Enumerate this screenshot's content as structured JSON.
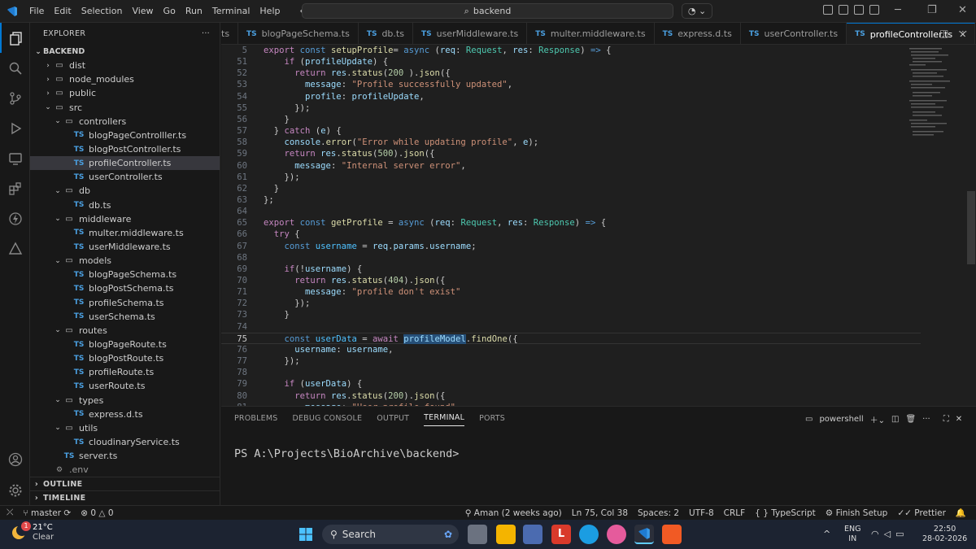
{
  "titlebar": {
    "menu": [
      "File",
      "Edit",
      "Selection",
      "View",
      "Go",
      "Run",
      "Terminal",
      "Help"
    ],
    "search": "backend"
  },
  "explorer": {
    "header": "EXPLORER",
    "root": "BACKEND",
    "tree": [
      {
        "depth": 1,
        "kind": "folder",
        "open": false,
        "name": "dist"
      },
      {
        "depth": 1,
        "kind": "folder",
        "open": false,
        "name": "node_modules"
      },
      {
        "depth": 1,
        "kind": "folder",
        "open": false,
        "name": "public"
      },
      {
        "depth": 1,
        "kind": "folder",
        "open": true,
        "name": "src"
      },
      {
        "depth": 2,
        "kind": "folder",
        "open": true,
        "name": "controllers"
      },
      {
        "depth": 3,
        "kind": "ts",
        "name": "blogPageControlller.ts"
      },
      {
        "depth": 3,
        "kind": "ts",
        "name": "blogPostController.ts"
      },
      {
        "depth": 3,
        "kind": "ts",
        "name": "profileController.ts",
        "selected": true
      },
      {
        "depth": 3,
        "kind": "ts",
        "name": "userController.ts"
      },
      {
        "depth": 2,
        "kind": "folder",
        "open": true,
        "name": "db"
      },
      {
        "depth": 3,
        "kind": "ts",
        "name": "db.ts"
      },
      {
        "depth": 2,
        "kind": "folder",
        "open": true,
        "name": "middleware"
      },
      {
        "depth": 3,
        "kind": "ts",
        "name": "multer.middleware.ts"
      },
      {
        "depth": 3,
        "kind": "ts",
        "name": "userMiddleware.ts"
      },
      {
        "depth": 2,
        "kind": "folder",
        "open": true,
        "name": "models"
      },
      {
        "depth": 3,
        "kind": "ts",
        "name": "blogPageSchema.ts"
      },
      {
        "depth": 3,
        "kind": "ts",
        "name": "blogPostSchema.ts"
      },
      {
        "depth": 3,
        "kind": "ts",
        "name": "profileSchema.ts"
      },
      {
        "depth": 3,
        "kind": "ts",
        "name": "userSchema.ts"
      },
      {
        "depth": 2,
        "kind": "folder",
        "open": true,
        "name": "routes"
      },
      {
        "depth": 3,
        "kind": "ts",
        "name": "blogPageRoute.ts"
      },
      {
        "depth": 3,
        "kind": "ts",
        "name": "blogPostRoute.ts"
      },
      {
        "depth": 3,
        "kind": "ts",
        "name": "profileRoute.ts"
      },
      {
        "depth": 3,
        "kind": "ts",
        "name": "userRoute.ts"
      },
      {
        "depth": 2,
        "kind": "folder",
        "open": true,
        "name": "types"
      },
      {
        "depth": 3,
        "kind": "ts",
        "name": "express.d.ts"
      },
      {
        "depth": 2,
        "kind": "folder",
        "open": true,
        "name": "utils"
      },
      {
        "depth": 3,
        "kind": "ts",
        "name": "cloudinaryService.ts"
      },
      {
        "depth": 2,
        "kind": "ts",
        "name": "server.ts"
      },
      {
        "depth": 1,
        "kind": "env",
        "name": ".env"
      }
    ],
    "outline": "OUTLINE",
    "timeline": "TIMELINE"
  },
  "tabs": [
    {
      "label": "ts",
      "icon": ""
    },
    {
      "label": "blogPageSchema.ts",
      "icon": "TS"
    },
    {
      "label": "db.ts",
      "icon": "TS"
    },
    {
      "label": "userMiddleware.ts",
      "icon": "TS"
    },
    {
      "label": "multer.middleware.ts",
      "icon": "TS"
    },
    {
      "label": "express.d.ts",
      "icon": "TS"
    },
    {
      "label": "userController.ts",
      "icon": "TS"
    },
    {
      "label": "profileController.ts",
      "icon": "TS",
      "active": true
    }
  ],
  "code": [
    {
      "n": "5",
      "t": [
        [
          "kw",
          "export "
        ],
        [
          "kd",
          "const "
        ],
        [
          "fn",
          "setupProfile"
        ],
        [
          "",
          "="
        ],
        [
          "kd",
          " async "
        ],
        [
          "",
          "("
        ],
        [
          "va",
          "req"
        ],
        [
          "",
          ": "
        ],
        [
          "ty",
          "Request"
        ],
        [
          "",
          ", "
        ],
        [
          "va",
          "res"
        ],
        [
          "",
          ": "
        ],
        [
          "ty",
          "Response"
        ],
        [
          "",
          ") "
        ],
        [
          "kd",
          "=>"
        ],
        [
          "",
          " {"
        ]
      ]
    },
    {
      "n": "51",
      "t": [
        [
          "",
          "    "
        ],
        [
          "kw",
          "if "
        ],
        [
          "",
          "("
        ],
        [
          "va",
          "profileUpdate"
        ],
        [
          ") {",
          ""
        ]
      ]
    },
    {
      "n": "52",
      "t": [
        [
          "",
          "      "
        ],
        [
          "kw",
          "return "
        ],
        [
          "va",
          "res"
        ],
        [
          "",
          "."
        ],
        [
          "fn",
          "status"
        ],
        [
          "",
          "("
        ],
        [
          "nu",
          "200"
        ],
        [
          "",
          " )."
        ],
        [
          "fn",
          "json"
        ],
        [
          "",
          "({"
        ]
      ]
    },
    {
      "n": "53",
      "t": [
        [
          "",
          "        "
        ],
        [
          "va",
          "message"
        ],
        [
          "",
          ": "
        ],
        [
          "st",
          "\"Profile successfully updated\""
        ],
        [
          "",
          ","
        ]
      ]
    },
    {
      "n": "54",
      "t": [
        [
          "",
          "        "
        ],
        [
          "va",
          "profile"
        ],
        [
          "",
          ": "
        ],
        [
          "va",
          "profileUpdate"
        ],
        [
          "",
          ","
        ]
      ]
    },
    {
      "n": "55",
      "t": [
        [
          "",
          "      });"
        ]
      ]
    },
    {
      "n": "56",
      "t": [
        [
          "",
          "    }"
        ]
      ]
    },
    {
      "n": "57",
      "t": [
        [
          "",
          "  } "
        ],
        [
          "kw",
          "catch "
        ],
        [
          "",
          "("
        ],
        [
          "va",
          "e"
        ],
        [
          "",
          ") {"
        ]
      ]
    },
    {
      "n": "58",
      "t": [
        [
          "",
          "    "
        ],
        [
          "va",
          "console"
        ],
        [
          "",
          "."
        ],
        [
          "fn",
          "error"
        ],
        [
          "",
          "("
        ],
        [
          "st",
          "\"Error while updating profile\""
        ],
        [
          "",
          ", "
        ],
        [
          "va",
          "e"
        ],
        [
          "",
          ");"
        ]
      ]
    },
    {
      "n": "59",
      "t": [
        [
          "",
          "    "
        ],
        [
          "kw",
          "return "
        ],
        [
          "va",
          "res"
        ],
        [
          "",
          "."
        ],
        [
          "fn",
          "status"
        ],
        [
          "",
          "("
        ],
        [
          "nu",
          "500"
        ],
        [
          "",
          ")."
        ],
        [
          "fn",
          "json"
        ],
        [
          "",
          "({"
        ]
      ]
    },
    {
      "n": "60",
      "t": [
        [
          "",
          "      "
        ],
        [
          "va",
          "message"
        ],
        [
          "",
          ": "
        ],
        [
          "st",
          "\"Internal server error\""
        ],
        [
          "",
          ","
        ]
      ]
    },
    {
      "n": "61",
      "t": [
        [
          "",
          "    });"
        ]
      ]
    },
    {
      "n": "62",
      "t": [
        [
          "",
          "  }"
        ]
      ]
    },
    {
      "n": "63",
      "t": [
        [
          "",
          "};"
        ]
      ]
    },
    {
      "n": "64",
      "t": []
    },
    {
      "n": "65",
      "t": [
        [
          "kw",
          "export "
        ],
        [
          "kd",
          "const "
        ],
        [
          "fn",
          "getProfile"
        ],
        [
          "",
          " = "
        ],
        [
          "kd",
          "async "
        ],
        [
          "",
          "("
        ],
        [
          "va",
          "req"
        ],
        [
          "",
          ": "
        ],
        [
          "ty",
          "Request"
        ],
        [
          "",
          ", "
        ],
        [
          "va",
          "res"
        ],
        [
          "",
          ": "
        ],
        [
          "ty",
          "Response"
        ],
        [
          "",
          ") "
        ],
        [
          "kd",
          "=>"
        ],
        [
          "",
          " {"
        ]
      ]
    },
    {
      "n": "66",
      "t": [
        [
          "",
          "  "
        ],
        [
          "kw",
          "try "
        ],
        [
          "",
          "{"
        ]
      ]
    },
    {
      "n": "67",
      "t": [
        [
          "",
          "    "
        ],
        [
          "kd",
          "const "
        ],
        [
          "co",
          "username"
        ],
        [
          "",
          " = "
        ],
        [
          "va",
          "req"
        ],
        [
          "",
          "."
        ],
        [
          "va",
          "params"
        ],
        [
          "",
          "."
        ],
        [
          "va",
          "username"
        ],
        [
          "",
          ";"
        ]
      ]
    },
    {
      "n": "68",
      "t": []
    },
    {
      "n": "69",
      "t": [
        [
          "",
          "    "
        ],
        [
          "kw",
          "if"
        ],
        [
          "",
          "(!"
        ],
        [
          "va",
          "username"
        ],
        [
          "",
          ") {"
        ]
      ]
    },
    {
      "n": "70",
      "t": [
        [
          "",
          "      "
        ],
        [
          "kw",
          "return "
        ],
        [
          "va",
          "res"
        ],
        [
          "",
          "."
        ],
        [
          "fn",
          "status"
        ],
        [
          "",
          "("
        ],
        [
          "nu",
          "404"
        ],
        [
          "",
          ")."
        ],
        [
          "fn",
          "json"
        ],
        [
          "",
          "({"
        ]
      ]
    },
    {
      "n": "71",
      "t": [
        [
          "",
          "        "
        ],
        [
          "va",
          "message"
        ],
        [
          "",
          ": "
        ],
        [
          "st",
          "\"profile don't exist\""
        ]
      ]
    },
    {
      "n": "72",
      "t": [
        [
          "",
          "      });"
        ]
      ]
    },
    {
      "n": "73",
      "t": [
        [
          "",
          "    }"
        ]
      ]
    },
    {
      "n": "74",
      "t": []
    },
    {
      "n": "75",
      "t": [
        [
          "",
          "    "
        ],
        [
          "kd",
          "const "
        ],
        [
          "co",
          "userData"
        ],
        [
          "",
          " = "
        ],
        [
          "kw",
          "await "
        ],
        [
          "va",
          "profileModel"
        ],
        [
          "",
          "."
        ],
        [
          "fn",
          "findOne"
        ],
        [
          "",
          "({"
        ]
      ],
      "cur": true
    },
    {
      "n": "76",
      "t": [
        [
          "",
          "      "
        ],
        [
          "va",
          "username"
        ],
        [
          "",
          ": "
        ],
        [
          "va",
          "username"
        ],
        [
          "",
          ","
        ]
      ]
    },
    {
      "n": "77",
      "t": [
        [
          "",
          "    });"
        ]
      ]
    },
    {
      "n": "78",
      "t": []
    },
    {
      "n": "79",
      "t": [
        [
          "",
          "    "
        ],
        [
          "kw",
          "if "
        ],
        [
          "",
          "("
        ],
        [
          "va",
          "userData"
        ],
        [
          "",
          ") {"
        ]
      ]
    },
    {
      "n": "80",
      "t": [
        [
          "",
          "      "
        ],
        [
          "kw",
          "return "
        ],
        [
          "va",
          "res"
        ],
        [
          "",
          "."
        ],
        [
          "fn",
          "status"
        ],
        [
          "",
          "("
        ],
        [
          "nu",
          "200"
        ],
        [
          "",
          ")."
        ],
        [
          "fn",
          "json"
        ],
        [
          "",
          "({"
        ]
      ]
    },
    {
      "n": "81",
      "t": [
        [
          "",
          "        "
        ],
        [
          "va",
          "message"
        ],
        [
          "",
          ": "
        ],
        [
          "st",
          "\"User profile found\""
        ],
        [
          "",
          ","
        ]
      ]
    }
  ],
  "panel": {
    "tabs": [
      "PROBLEMS",
      "DEBUG CONSOLE",
      "OUTPUT",
      "TERMINAL",
      "PORTS"
    ],
    "active_tab": "TERMINAL",
    "shell": "powershell",
    "prompt": "PS A:\\Projects\\BioArchive\\backend>"
  },
  "statusbar": {
    "branch": "master",
    "errors": "0",
    "warnings": "0",
    "blame": "Aman (2 weeks ago)",
    "position": "Ln 75, Col 38",
    "spaces": "Spaces: 2",
    "encoding": "UTF-8",
    "eol": "CRLF",
    "language": "TypeScript",
    "finish": "Finish Setup",
    "prettier": "Prettier"
  },
  "taskbar": {
    "weather_temp": "21°C",
    "weather_desc": "Clear",
    "search": "Search",
    "lang_top": "ENG",
    "lang_bottom": "IN",
    "time": "22:50",
    "date": "28-02-2026",
    "notif_badge": "1"
  }
}
